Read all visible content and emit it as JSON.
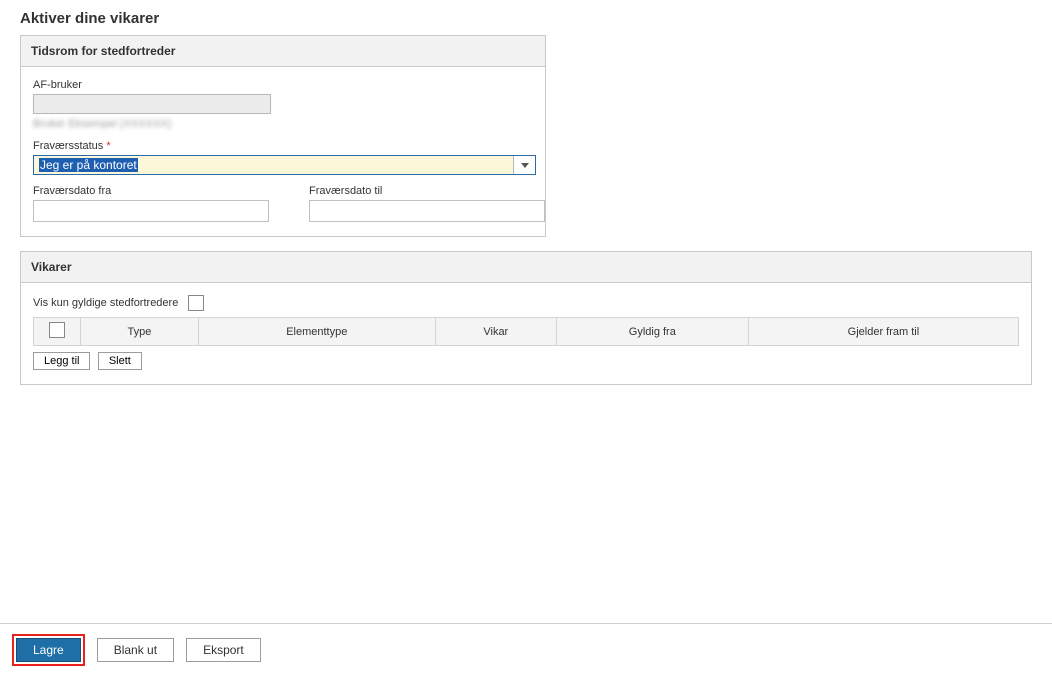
{
  "page": {
    "title": "Aktiver dine vikarer"
  },
  "panel_time": {
    "title": "Tidsrom for stedfortreder",
    "user_label": "AF-bruker",
    "user_value": "",
    "user_info": "Bruker Eksempel (XXXXXX)",
    "status_label": "Fraværsstatus",
    "status_value": "Jeg er på kontoret",
    "from_label": "Fraværsdato fra",
    "to_label": "Fraværsdato til"
  },
  "panel_vikar": {
    "title": "Vikarer",
    "vis_label": "Vis kun gyldige stedfortredere",
    "cols": {
      "type": "Type",
      "elementtype": "Elementtype",
      "vikar": "Vikar",
      "fra": "Gyldig fra",
      "til": "Gjelder fram til"
    },
    "add": "Legg til",
    "del": "Slett"
  },
  "footer": {
    "save": "Lagre",
    "blank": "Blank ut",
    "export": "Eksport"
  }
}
